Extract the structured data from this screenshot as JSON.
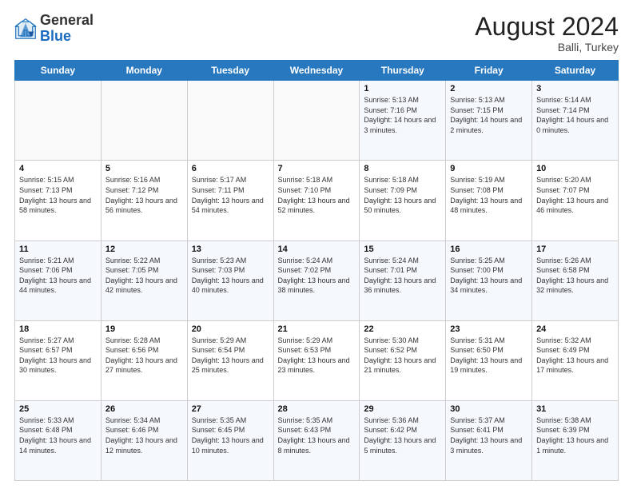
{
  "header": {
    "logo": {
      "line1": "General",
      "line2": "Blue"
    },
    "month_year": "August 2024",
    "location": "Balli, Turkey"
  },
  "weekdays": [
    "Sunday",
    "Monday",
    "Tuesday",
    "Wednesday",
    "Thursday",
    "Friday",
    "Saturday"
  ],
  "weeks": [
    [
      {
        "day": "",
        "sunrise": "",
        "sunset": "",
        "daylight": ""
      },
      {
        "day": "",
        "sunrise": "",
        "sunset": "",
        "daylight": ""
      },
      {
        "day": "",
        "sunrise": "",
        "sunset": "",
        "daylight": ""
      },
      {
        "day": "",
        "sunrise": "",
        "sunset": "",
        "daylight": ""
      },
      {
        "day": "1",
        "sunrise": "5:13 AM",
        "sunset": "7:16 PM",
        "daylight": "14 hours and 3 minutes."
      },
      {
        "day": "2",
        "sunrise": "5:13 AM",
        "sunset": "7:15 PM",
        "daylight": "14 hours and 2 minutes."
      },
      {
        "day": "3",
        "sunrise": "5:14 AM",
        "sunset": "7:14 PM",
        "daylight": "14 hours and 0 minutes."
      }
    ],
    [
      {
        "day": "4",
        "sunrise": "5:15 AM",
        "sunset": "7:13 PM",
        "daylight": "13 hours and 58 minutes."
      },
      {
        "day": "5",
        "sunrise": "5:16 AM",
        "sunset": "7:12 PM",
        "daylight": "13 hours and 56 minutes."
      },
      {
        "day": "6",
        "sunrise": "5:17 AM",
        "sunset": "7:11 PM",
        "daylight": "13 hours and 54 minutes."
      },
      {
        "day": "7",
        "sunrise": "5:18 AM",
        "sunset": "7:10 PM",
        "daylight": "13 hours and 52 minutes."
      },
      {
        "day": "8",
        "sunrise": "5:18 AM",
        "sunset": "7:09 PM",
        "daylight": "13 hours and 50 minutes."
      },
      {
        "day": "9",
        "sunrise": "5:19 AM",
        "sunset": "7:08 PM",
        "daylight": "13 hours and 48 minutes."
      },
      {
        "day": "10",
        "sunrise": "5:20 AM",
        "sunset": "7:07 PM",
        "daylight": "13 hours and 46 minutes."
      }
    ],
    [
      {
        "day": "11",
        "sunrise": "5:21 AM",
        "sunset": "7:06 PM",
        "daylight": "13 hours and 44 minutes."
      },
      {
        "day": "12",
        "sunrise": "5:22 AM",
        "sunset": "7:05 PM",
        "daylight": "13 hours and 42 minutes."
      },
      {
        "day": "13",
        "sunrise": "5:23 AM",
        "sunset": "7:03 PM",
        "daylight": "13 hours and 40 minutes."
      },
      {
        "day": "14",
        "sunrise": "5:24 AM",
        "sunset": "7:02 PM",
        "daylight": "13 hours and 38 minutes."
      },
      {
        "day": "15",
        "sunrise": "5:24 AM",
        "sunset": "7:01 PM",
        "daylight": "13 hours and 36 minutes."
      },
      {
        "day": "16",
        "sunrise": "5:25 AM",
        "sunset": "7:00 PM",
        "daylight": "13 hours and 34 minutes."
      },
      {
        "day": "17",
        "sunrise": "5:26 AM",
        "sunset": "6:58 PM",
        "daylight": "13 hours and 32 minutes."
      }
    ],
    [
      {
        "day": "18",
        "sunrise": "5:27 AM",
        "sunset": "6:57 PM",
        "daylight": "13 hours and 30 minutes."
      },
      {
        "day": "19",
        "sunrise": "5:28 AM",
        "sunset": "6:56 PM",
        "daylight": "13 hours and 27 minutes."
      },
      {
        "day": "20",
        "sunrise": "5:29 AM",
        "sunset": "6:54 PM",
        "daylight": "13 hours and 25 minutes."
      },
      {
        "day": "21",
        "sunrise": "5:29 AM",
        "sunset": "6:53 PM",
        "daylight": "13 hours and 23 minutes."
      },
      {
        "day": "22",
        "sunrise": "5:30 AM",
        "sunset": "6:52 PM",
        "daylight": "13 hours and 21 minutes."
      },
      {
        "day": "23",
        "sunrise": "5:31 AM",
        "sunset": "6:50 PM",
        "daylight": "13 hours and 19 minutes."
      },
      {
        "day": "24",
        "sunrise": "5:32 AM",
        "sunset": "6:49 PM",
        "daylight": "13 hours and 17 minutes."
      }
    ],
    [
      {
        "day": "25",
        "sunrise": "5:33 AM",
        "sunset": "6:48 PM",
        "daylight": "13 hours and 14 minutes."
      },
      {
        "day": "26",
        "sunrise": "5:34 AM",
        "sunset": "6:46 PM",
        "daylight": "13 hours and 12 minutes."
      },
      {
        "day": "27",
        "sunrise": "5:35 AM",
        "sunset": "6:45 PM",
        "daylight": "13 hours and 10 minutes."
      },
      {
        "day": "28",
        "sunrise": "5:35 AM",
        "sunset": "6:43 PM",
        "daylight": "13 hours and 8 minutes."
      },
      {
        "day": "29",
        "sunrise": "5:36 AM",
        "sunset": "6:42 PM",
        "daylight": "13 hours and 5 minutes."
      },
      {
        "day": "30",
        "sunrise": "5:37 AM",
        "sunset": "6:41 PM",
        "daylight": "13 hours and 3 minutes."
      },
      {
        "day": "31",
        "sunrise": "5:38 AM",
        "sunset": "6:39 PM",
        "daylight": "13 hours and 1 minute."
      }
    ]
  ],
  "labels": {
    "sunrise": "Sunrise:",
    "sunset": "Sunset:",
    "daylight": "Daylight:"
  }
}
